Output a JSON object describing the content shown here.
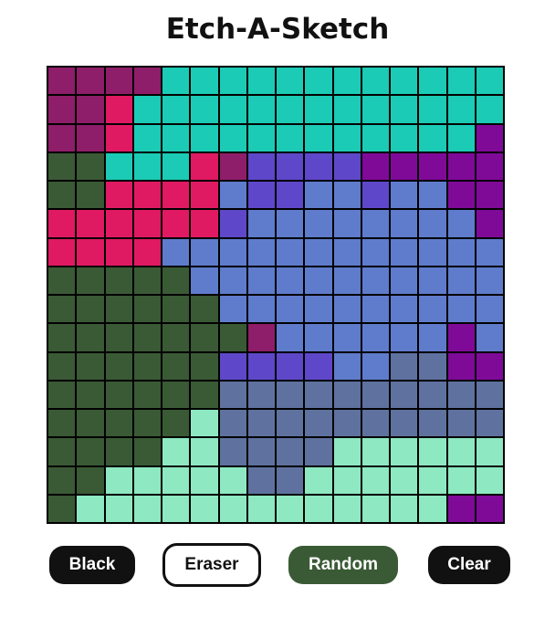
{
  "title": "Etch-A-Sketch",
  "buttons": {
    "black": "Black",
    "eraser": "Eraser",
    "random": "Random",
    "clear": "Clear"
  },
  "grid": {
    "size": 16,
    "palette": {
      "P": "#8e1e69",
      "T": "#1bcbb5",
      "R": "#e01a62",
      "G": "#3a5a35",
      "V": "#800a98",
      "I": "#5e48c9",
      "B": "#5f7ccc",
      "S": "#5f729f",
      "M": "#8ee8c2"
    },
    "rows": [
      "PPPPTTTTTTTTTTTT",
      "PPRTTTTTTTTTTTTT",
      "PPRTTTTTTTTTTTTV",
      "GGTTTRPIIIIVVVVV",
      "GGRRRRBIIBBIBBVV",
      "RRRRRRIBBBBBBBBV",
      "RRRRBBBBBBBBBBBB",
      "GGGGGBBBBBBBBBBB",
      "GGGGGGBBBBBBBBBB",
      "GGGGGGGPBBBBBBVB",
      "GGGGGGIIIIBBSSVV",
      "GGGGGGSSSSSSSSSS",
      "GGGGGMSSSSSSSSSS",
      "GGGGMMSSSSMMMMMM",
      "GGMMMMMSSMMMMMMM",
      "GMMMMMMMMMMMMMVV"
    ]
  }
}
